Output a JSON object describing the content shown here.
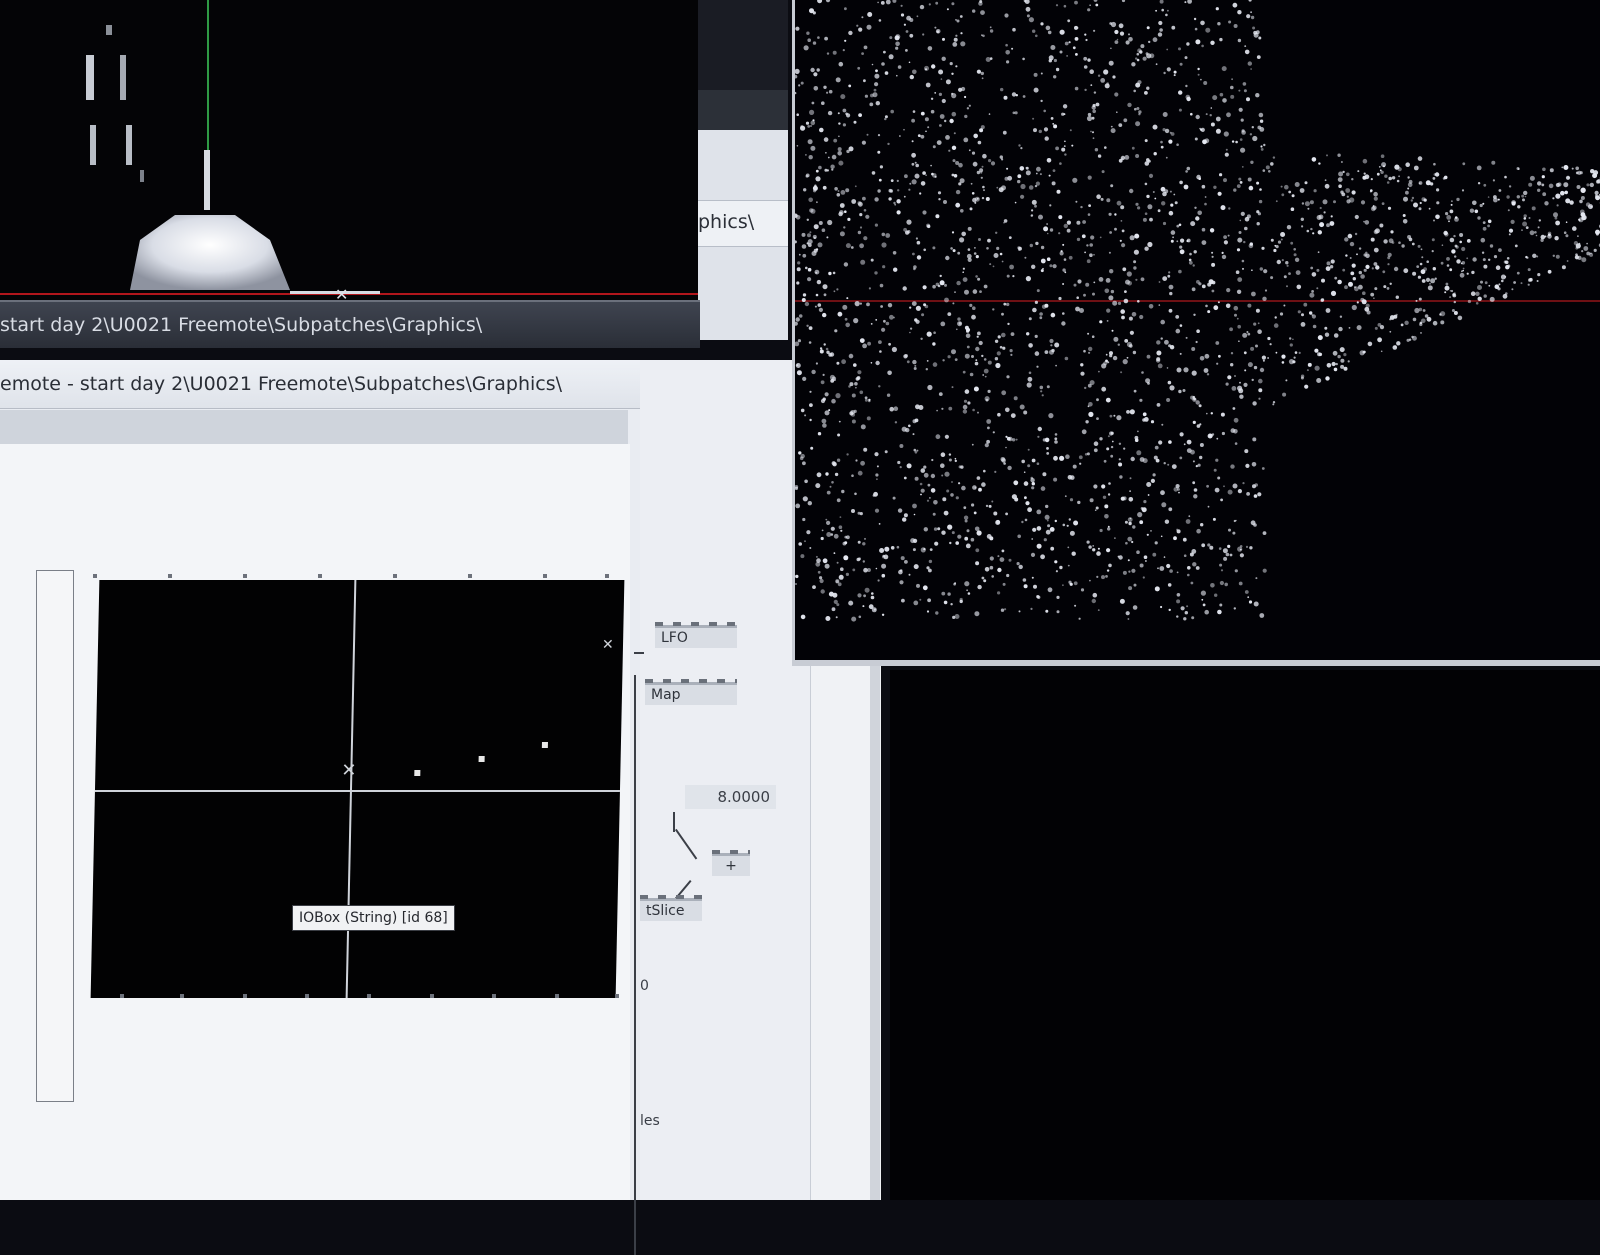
{
  "back_window": {
    "title_path": "start day 2\\U0021 Freemote\\Subpatches\\Graphics\\",
    "strip_label": "phics\\"
  },
  "patch_window": {
    "title_path": "emote - start day 2\\U0021 Freemote\\Subpatches\\Graphics\\",
    "tooltip": "IOBox (String) [id 68]"
  },
  "nodes": {
    "lfo": "LFO",
    "map": "Map",
    "value": "8.0000",
    "plus": "+",
    "getslice": "tSlice",
    "partial_a": "0",
    "partial_b": "les"
  }
}
